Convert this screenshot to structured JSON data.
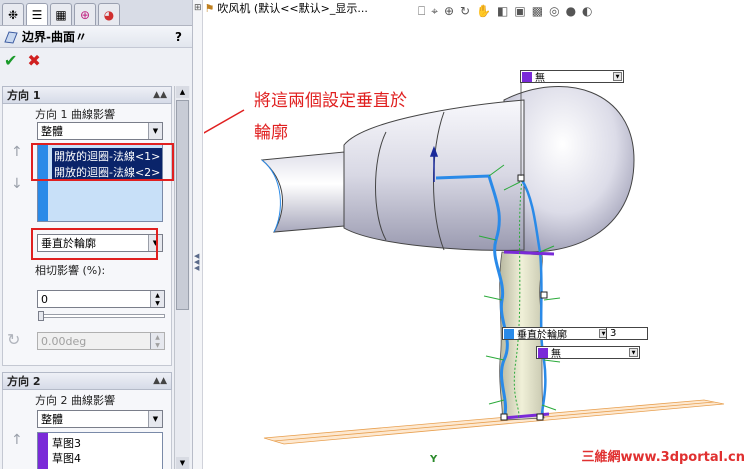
{
  "pm": {
    "tabs": [
      {
        "icon": "feature-manager-icon",
        "glyph": "❉"
      },
      {
        "icon": "property-manager-icon",
        "glyph": "☰"
      },
      {
        "icon": "configuration-manager-icon",
        "glyph": "▦"
      },
      {
        "icon": "dimxpert-icon",
        "glyph": "⊕"
      },
      {
        "icon": "display-manager-icon",
        "glyph": "◕"
      }
    ],
    "title": "边界-曲面〃",
    "help": "?",
    "ok_glyph": "✔",
    "cancel_glyph": "✖",
    "dir1": {
      "header": "方向 1",
      "influence_label": "方向 1 曲線影響",
      "influence_value": "整體",
      "items": [
        "開放的迴圈-法線<1>",
        "開放的迴圈-法線<2>"
      ],
      "tangent_type": "垂直於輪廓",
      "tangent_influence_label": "相切影響 (%):",
      "tangent_influence_value": "0",
      "angle_value": "0.00deg"
    },
    "dir2": {
      "header": "方向 2",
      "influence_label": "方向 2 曲線影響",
      "influence_value": "整體",
      "items": [
        "草图3",
        "草图4"
      ]
    }
  },
  "graphics": {
    "tree_label": "吹风机  (默认<<默认>_显示...",
    "annotation_line1": "將這兩個設定垂直於",
    "annotation_line2": "輪廓",
    "callout_top": "無",
    "callout_mid": "垂直於輪廓",
    "callout_mid_num": "3",
    "callout_low": "無",
    "watermark": "三維網www.3dportal.cn",
    "axis_label": "Y",
    "heads_up_icons": [
      "zoom-fit-icon",
      "zoom-area-icon",
      "zoom-in-icon",
      "rotate-icon",
      "pan-icon",
      "section-view-icon",
      "view-orient-icon",
      "display-style-icon",
      "hide-show-icon",
      "appearance-icon",
      "scene-icon"
    ]
  },
  "colors": {
    "annotation_red": "#e02020",
    "selection_blue": "#0a246a",
    "curve_blue": "#2a8ae8",
    "curve_purple": "#7a2ad8",
    "grid_orange": "#e8a050"
  }
}
